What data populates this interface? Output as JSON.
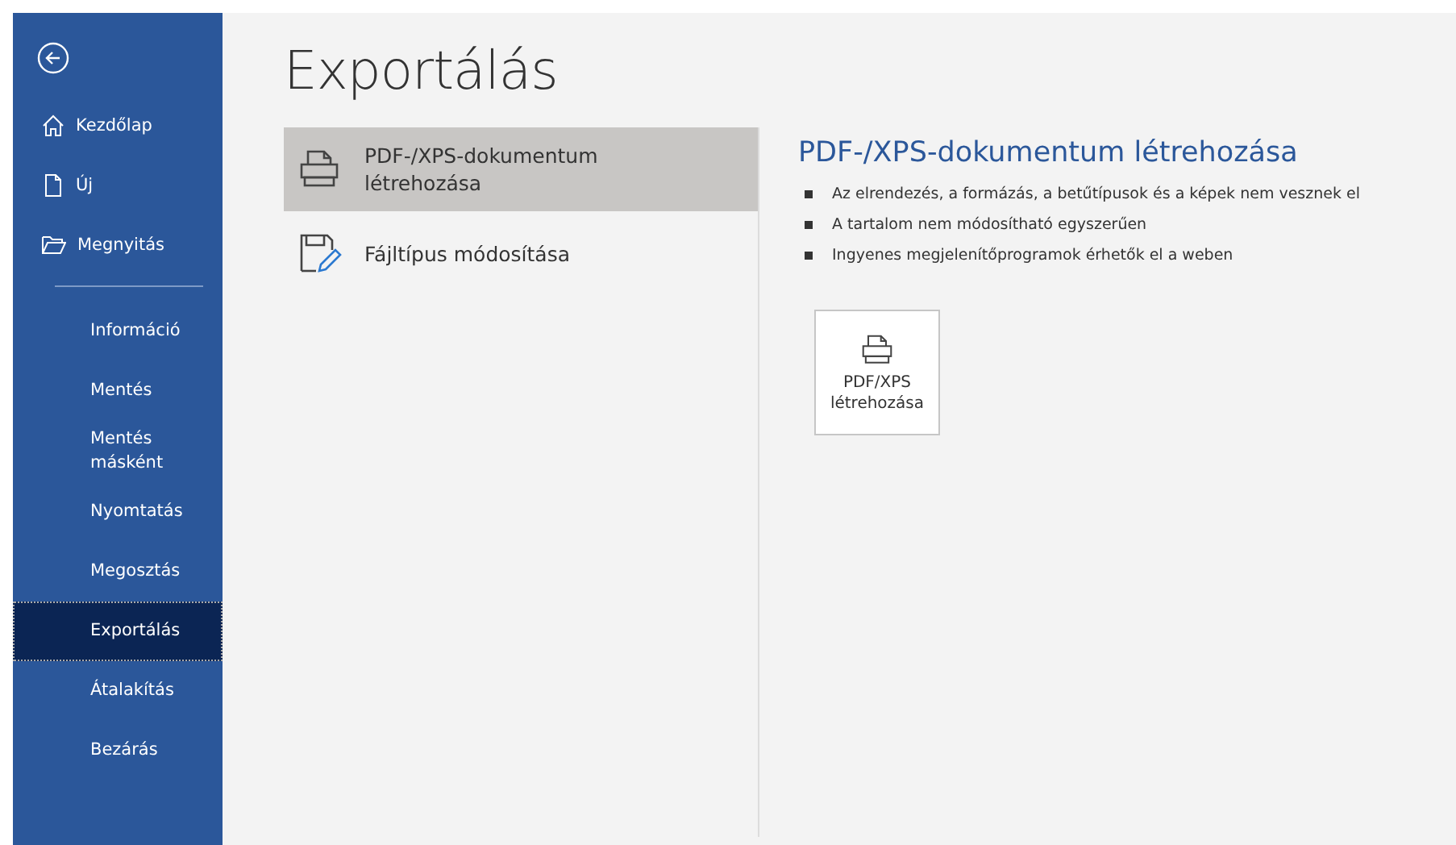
{
  "sidebar": {
    "top_items": [
      {
        "label": "Kezdőlap",
        "kind": "home"
      },
      {
        "label": "Új",
        "kind": "new"
      },
      {
        "label": "Megnyitás",
        "kind": "open"
      }
    ],
    "items": [
      {
        "label": "Információ",
        "selected": false
      },
      {
        "label": "Mentés",
        "selected": false
      },
      {
        "label": "Mentés másként",
        "selected": false
      },
      {
        "label": "Nyomtatás",
        "selected": false
      },
      {
        "label": "Megosztás",
        "selected": false
      },
      {
        "label": "Exportálás",
        "selected": true
      },
      {
        "label": "Átalakítás",
        "selected": false
      },
      {
        "label": "Bezárás",
        "selected": false
      }
    ]
  },
  "title": "Exportálás",
  "options": [
    {
      "label": "PDF-/XPS-dokumentum létrehozása",
      "kind": "pdf",
      "selected": true
    },
    {
      "label": "Fájltípus módosítása",
      "kind": "filetype",
      "selected": false
    }
  ],
  "detail": {
    "heading": "PDF-/XPS-dokumentum létrehozása",
    "bullets": [
      "Az elrendezés, a formázás, a betűtípusok és a képek nem vesznek el",
      "A tartalom nem módosítható egyszerűen",
      "Ingyenes megjelenítőprogramok érhetők el a weben"
    ],
    "button": {
      "label": "PDF/XPS létrehozása"
    }
  }
}
